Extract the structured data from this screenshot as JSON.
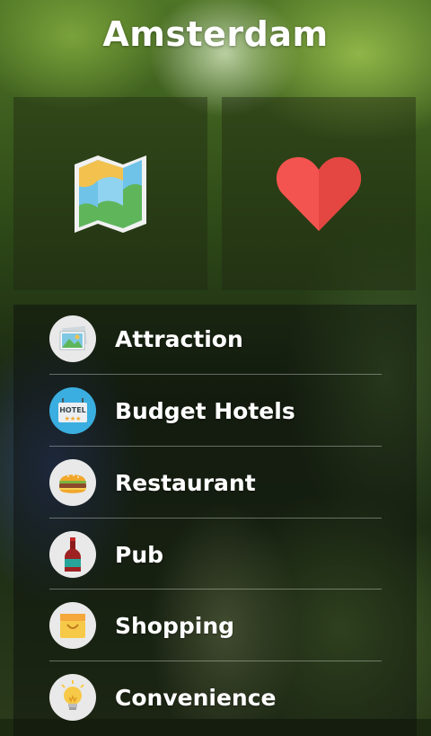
{
  "header": {
    "title": "Amsterdam"
  },
  "tiles": [
    {
      "name": "map",
      "icon": "map-icon"
    },
    {
      "name": "favorites",
      "icon": "heart-icon"
    }
  ],
  "menu": {
    "items": [
      {
        "label": "Attraction",
        "icon": "photo-icon"
      },
      {
        "label": "Budget Hotels",
        "icon": "hotel-sign-icon"
      },
      {
        "label": "Restaurant",
        "icon": "burger-icon"
      },
      {
        "label": "Pub",
        "icon": "wine-bottle-icon"
      },
      {
        "label": "Shopping",
        "icon": "shopping-bag-icon"
      },
      {
        "label": "Convenience",
        "icon": "lightbulb-icon"
      }
    ]
  },
  "colors": {
    "heart": "#f4544f",
    "icon_circle": "#e9e9e9",
    "text": "#ffffff"
  }
}
